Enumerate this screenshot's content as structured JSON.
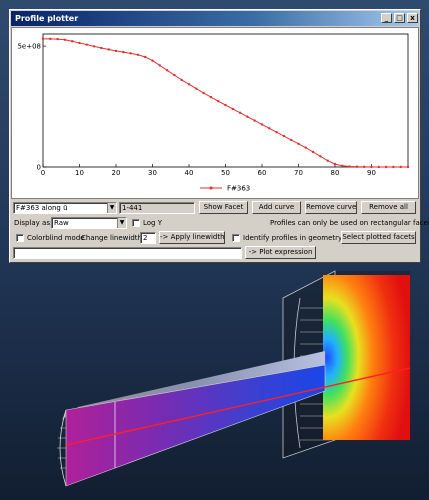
{
  "window": {
    "title": "Profile plotter",
    "buttons": [
      "_",
      "□",
      "x"
    ]
  },
  "controls": {
    "profile_select": "F#363 along ū",
    "range_value": "1-441",
    "show_facet": "Show Facet",
    "add_curve": "Add curve",
    "remove_curve": "Remove curve",
    "remove_all": "Remove all",
    "display_as_label": "Display as:",
    "display_as_value": "Raw",
    "log_y_label": "Log Y",
    "rectangular_note": "Profiles can only be used on rectangular facets.",
    "colorblind_label": "Colorblind mode",
    "change_linewidth_label": "Change linewidth:",
    "linewidth_value": "2",
    "apply_linewidth": "-> Apply linewidth",
    "identify_label": "Identify profiles in geometry",
    "select_plotted": "Select plotted facets",
    "expression_value": "",
    "plot_expression": "-> Plot expression"
  },
  "chart_data": {
    "type": "line",
    "title": "",
    "xlabel": "",
    "ylabel": "",
    "xlim": [
      0,
      100
    ],
    "ylim": [
      0,
      550000000.0
    ],
    "x_ticks": [
      "0",
      "10",
      "20",
      "30",
      "40",
      "50",
      "60",
      "70",
      "80",
      "90"
    ],
    "y_ticks": [
      "0",
      "5e+08"
    ],
    "legend": "bottom-center",
    "series": [
      {
        "name": "F#363",
        "color": "#e03030",
        "x": [
          0,
          2,
          4,
          6,
          8,
          10,
          12,
          14,
          16,
          18,
          20,
          22,
          24,
          26,
          28,
          30,
          32,
          34,
          36,
          38,
          40,
          42,
          44,
          46,
          48,
          50,
          52,
          54,
          56,
          58,
          60,
          62,
          64,
          66,
          68,
          70,
          72,
          74,
          76,
          78,
          80,
          82,
          84,
          86,
          88,
          90,
          92,
          94,
          96,
          98,
          100
        ],
        "y": [
          530000000.0,
          530000000.0,
          529000000.0,
          526000000.0,
          520000000.0,
          513000000.0,
          506000000.0,
          499000000.0,
          492000000.0,
          486000000.0,
          480000000.0,
          475000000.0,
          470000000.0,
          464000000.0,
          455000000.0,
          440000000.0,
          420000000.0,
          400000000.0,
          380000000.0,
          360000000.0,
          342000000.0,
          324000000.0,
          306000000.0,
          289000000.0,
          272000000.0,
          256000000.0,
          240000000.0,
          224000000.0,
          208000000.0,
          192000000.0,
          176000000.0,
          160000000.0,
          144000000.0,
          128000000.0,
          112000000.0,
          96000000.0,
          80000000.0,
          62000000.0,
          44000000.0,
          26000000.0,
          12000000.0,
          5000000.0,
          2000000.0,
          1000000.0,
          500000.0,
          200000.0,
          100000.0,
          50000.0,
          20000.0,
          10000.0,
          0
        ]
      }
    ]
  }
}
